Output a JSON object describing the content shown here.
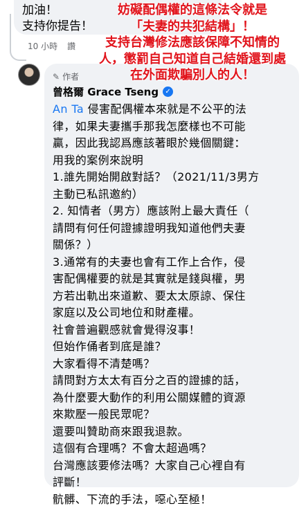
{
  "previous_comment": {
    "lines": [
      "加油！",
      "支持你提告！"
    ],
    "time": "10 小時",
    "reply_label": "讚"
  },
  "reply": {
    "author_badge": "作者",
    "author_name": "曾格爾 Grace Tseng",
    "mention": "An Ta",
    "first_line_rest": " 侵害配偶權本來就是不公平的法",
    "lines": [
      "律，如果夫妻攜手那我怎麼樣也不可能",
      "贏，因此我認爲應該著眼於幾個關鍵：",
      "用我的案例來說明",
      "1.誰先開始開啟對話？（2021/11/3男方",
      "主動已私訊邀約）",
      "2. 知情者（男方）應該附上最大責任（",
      "請問有何任何證據證明我知道他們夫妻",
      "關係？）",
      "3.通常有的夫妻也會有工作上合作，侵",
      "害配偶權要的就是其實就是錢與權，男",
      "方若出軌出來道歉、要太太原諒、保住",
      "家庭以及公司地位和財產權。",
      "社會普遍觀感就會覺得沒事！",
      "但始作俑者到底是誰？",
      "大家看得不清楚嗎？",
      "請問對方太太有百分之百的證據的話，",
      "為什麼要大動作的利用公關媒體的資源",
      "來欺壓一般民眾呢？",
      "還要叫贊助商來跟我退款。",
      "這個有合理嗎？不會太超過嗎？",
      "台灣應該要修法嗎？大家自己心裡自有",
      "評斷！",
      "骯髒、下流的手法，噁心至極！"
    ]
  },
  "overlay_annotation": {
    "lines": [
      "妨礙配偶權的這條法令就是",
      "「夫妻的共犯結構」！",
      "支持台灣修法應該保障不知情的",
      "人，懲罰自己知道自己結婚還到處",
      "在外面欺騙別人的人！"
    ],
    "color": "#e1131b"
  },
  "icons": {
    "author_badge_icon": "pen-icon",
    "verified_icon": "verified-check-icon"
  }
}
